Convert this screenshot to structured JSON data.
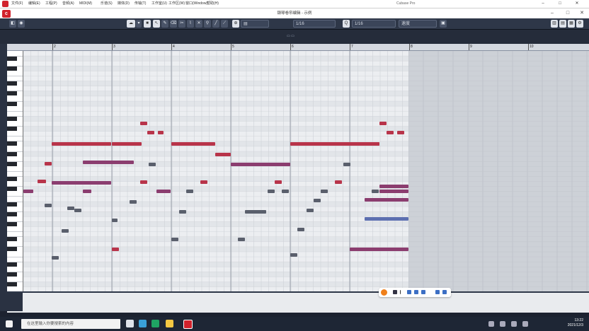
{
  "app": {
    "title": "钢琴卷帘编辑 - 示例",
    "corner_label": "Cubase Pro"
  },
  "menu": [
    "文件(F)",
    "编辑(E)",
    "工程(P)",
    "音频(A)",
    "MIDI(M)",
    "乐谱(S)",
    "媒体(D)",
    "传输(T)",
    "工作室(U)",
    "工作区(W)",
    "窗口(Window)",
    "帮助(H)"
  ],
  "toolbar": {
    "quantize_value": "1/16",
    "length_value": "1/16",
    "snap_label": "音阶",
    "color_label": "速度"
  },
  "ruler": {
    "bars": [
      "2",
      "3",
      "4",
      "5",
      "6",
      "7",
      "8",
      "9",
      "10"
    ]
  },
  "colors": {
    "note_red": "#b8344a",
    "note_purple": "#8b3d6f",
    "note_gray": "#5a5f6c",
    "note_blue": "#5d6fb0",
    "accent": "#d1222c"
  },
  "taskbar": {
    "search_placeholder": "在这里输入你要搜索的内容",
    "time": "13:22",
    "date": "2021/12/3"
  }
}
